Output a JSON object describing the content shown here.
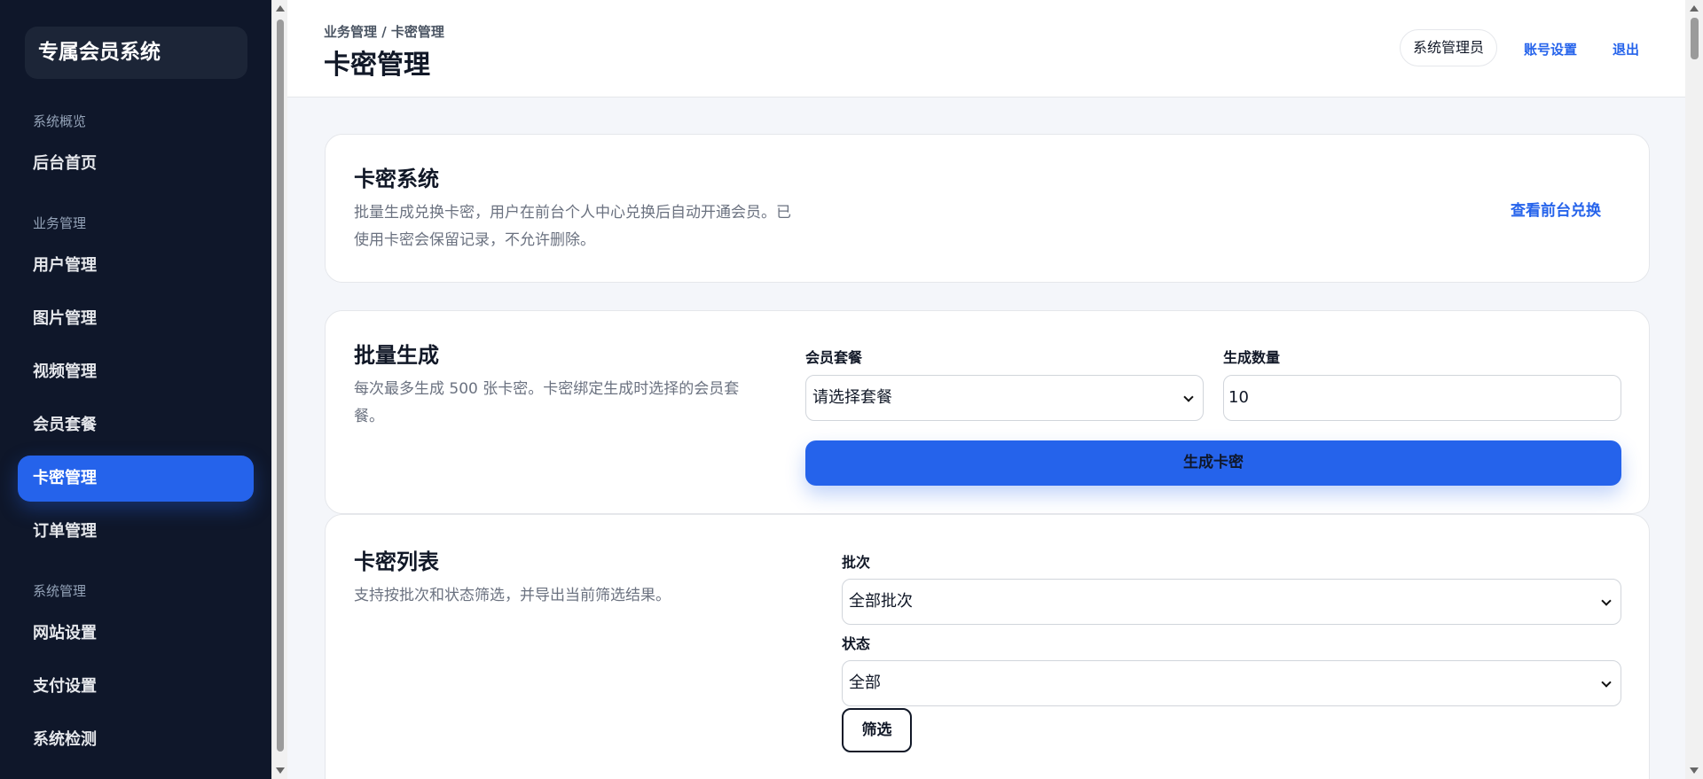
{
  "sidebar": {
    "brand": "专属会员系统",
    "groups": [
      "系统概览",
      "业务管理",
      "系统管理"
    ],
    "items": [
      "后台首页",
      "用户管理",
      "图片管理",
      "视频管理",
      "会员套餐",
      "卡密管理",
      "订单管理",
      "网站设置",
      "支付设置",
      "系统检测"
    ],
    "active_item": "卡密管理"
  },
  "header": {
    "breadcrumb": "业务管理 / 卡密管理",
    "title": "卡密管理",
    "user": "系统管理员",
    "account_link": "账号设置",
    "logout_link": "退出"
  },
  "intro_card": {
    "title": "卡密系统",
    "desc_line1": "批量生成兑换卡密，用户在前台个人中心兑换后自动开通会员。已",
    "desc_line2": "使用卡密会保留记录，不允许删除。",
    "link": "查看前台兑换"
  },
  "generate_card": {
    "title": "批量生成",
    "desc_line1": "每次最多生成 500 张卡密。卡密绑定生成时选择的会员套",
    "desc_line2": "餐。",
    "plan_label": "会员套餐",
    "plan_value": "请选择套餐",
    "count_label": "生成数量",
    "count_value": "10",
    "submit": "生成卡密"
  },
  "list_card": {
    "title": "卡密列表",
    "desc": "支持按批次和状态筛选，并导出当前筛选结果。",
    "batch_label": "批次",
    "batch_value": "全部批次",
    "status_label": "状态",
    "status_value": "全部",
    "filter_button": "筛选"
  },
  "colors": {
    "sidebar_bg": "#0f172a",
    "accent": "#2563eb",
    "page_bg": "#f4f6fa"
  }
}
